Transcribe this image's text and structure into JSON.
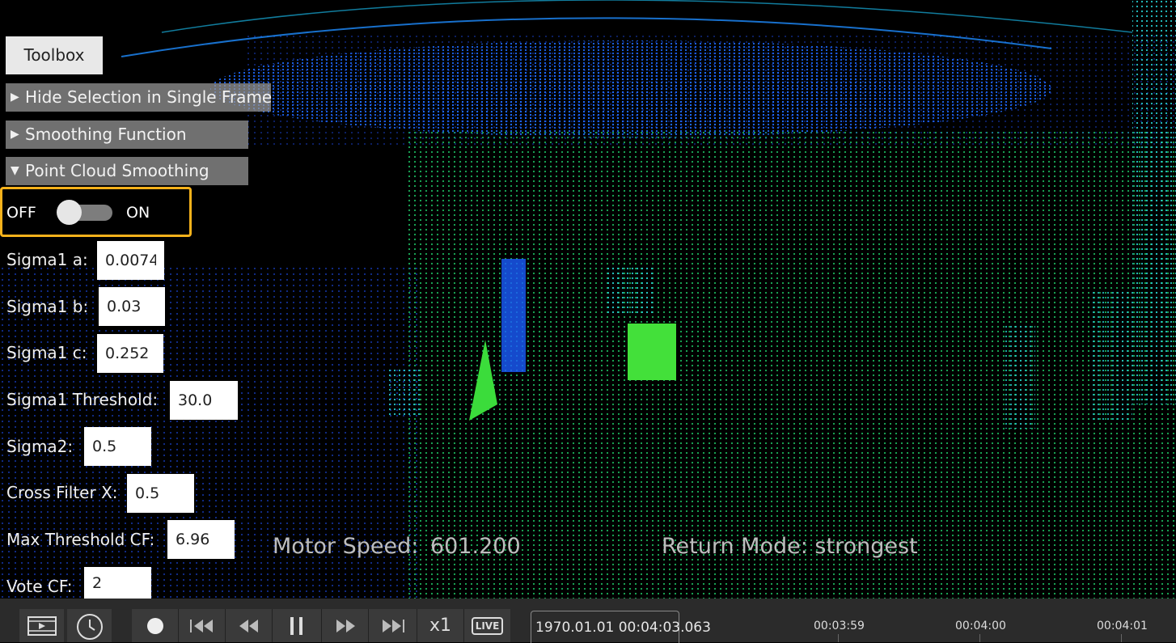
{
  "toolbox": {
    "label": "Toolbox"
  },
  "sections": [
    {
      "label": "Hide Selection in Single Frame",
      "expanded": false
    },
    {
      "label": "Smoothing Function",
      "expanded": false
    },
    {
      "label": "Point Cloud Smoothing",
      "expanded": true
    }
  ],
  "toggle": {
    "off_label": "OFF",
    "on_label": "ON",
    "state": "OFF"
  },
  "params": [
    {
      "label": "Sigma1 a:",
      "value": "0.0074"
    },
    {
      "label": "Sigma1 b:",
      "value": "0.03"
    },
    {
      "label": "Sigma1 c:",
      "value": "0.252"
    },
    {
      "label": "Sigma1 Threshold:",
      "value": "30.0"
    },
    {
      "label": "Sigma2:",
      "value": "0.5"
    },
    {
      "label": "Cross Filter X:",
      "value": "0.5"
    },
    {
      "label": "Max Threshold CF:",
      "value": "6.96"
    },
    {
      "label": "Vote CF:",
      "value": "2"
    }
  ],
  "status": {
    "motor_speed_label": "Motor Speed:",
    "motor_speed_value": "601.200",
    "return_mode": "Return Mode: strongest"
  },
  "playback": {
    "speed": "x1",
    "live_label": "LIVE",
    "timestamp": "1970.01.01 00:04:03.063",
    "ticks": [
      "00:03:59",
      "00:04:00",
      "00:04:01"
    ]
  },
  "colors": {
    "highlight": "#f6b21b",
    "cloud_blue": "#1f5cff",
    "cloud_green": "#22dd66"
  },
  "icons": {
    "play_mode": "video-icon",
    "history": "clock-icon",
    "record": "record-icon",
    "skip_back": "skip-back-icon",
    "rewind": "rewind-icon",
    "pause": "pause-icon",
    "fast_forward": "fast-forward-icon",
    "skip_forward": "skip-forward-icon",
    "live": "live-icon"
  }
}
